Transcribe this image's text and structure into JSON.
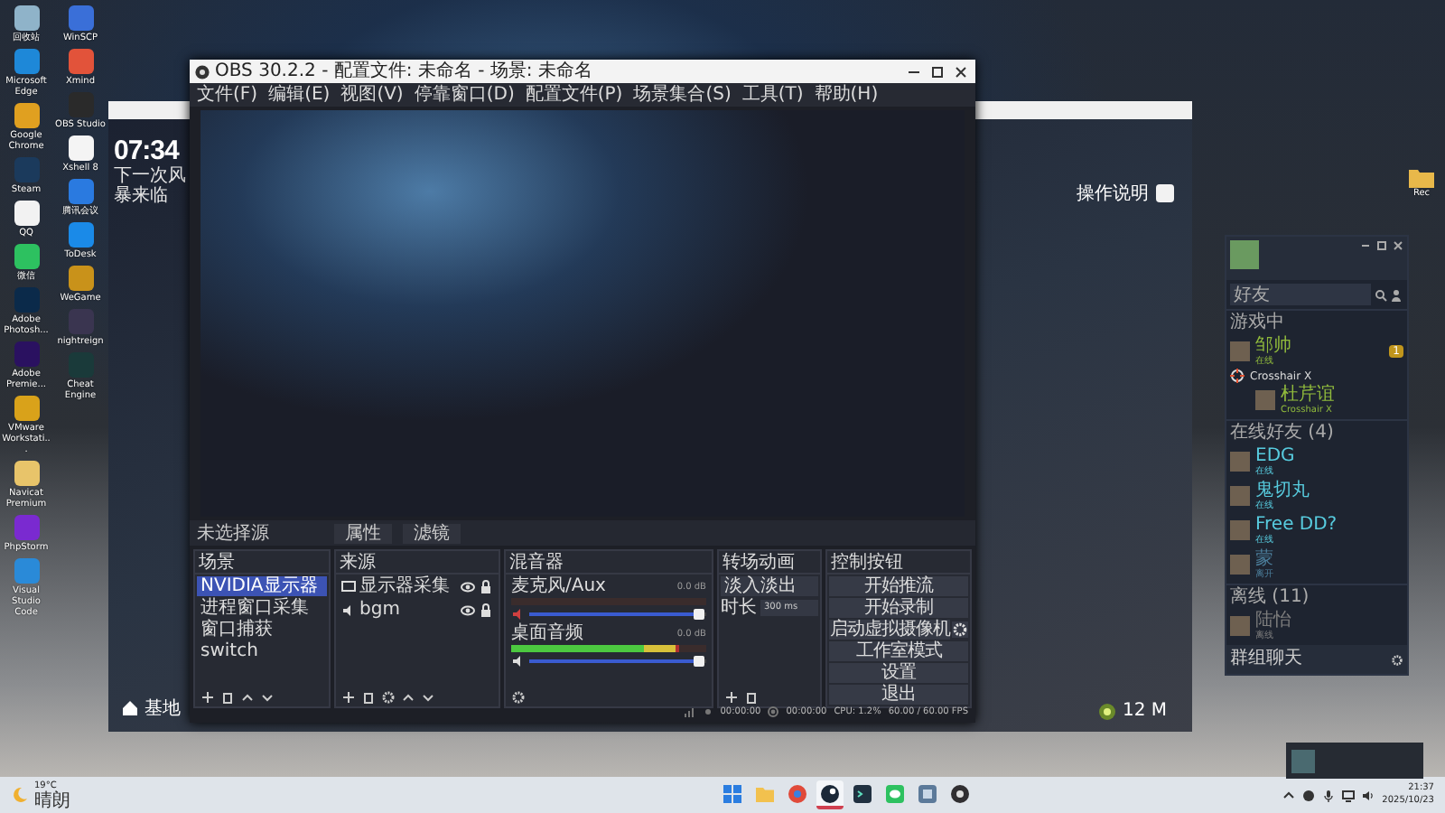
{
  "desktop_icons": {
    "left_column": [
      {
        "label": "回收站",
        "color": "#8fb3c9"
      },
      {
        "label": "Microsoft Edge",
        "color": "#1e88d8"
      },
      {
        "label": "Google Chrome",
        "color": "#e0a020"
      },
      {
        "label": "Steam",
        "color": "#1b3a5c"
      },
      {
        "label": "QQ",
        "color": "#f2f2f2"
      },
      {
        "label": "微信",
        "color": "#2dc160"
      },
      {
        "label": "Adobe Photosh...",
        "color": "#0b2a4a"
      },
      {
        "label": "Adobe Premie...",
        "color": "#2a1160"
      },
      {
        "label": "VMware Workstati...",
        "color": "#d9a21a"
      },
      {
        "label": "Navicat Premium",
        "color": "#e8c46a"
      },
      {
        "label": "PhpStorm",
        "color": "#7a2ad0"
      },
      {
        "label": "Visual Studio Code",
        "color": "#2a8ad8"
      }
    ],
    "right_column": [
      {
        "label": "WinSCP",
        "color": "#3a6fd8"
      },
      {
        "label": "Xmind",
        "color": "#e2533a"
      },
      {
        "label": "OBS Studio",
        "color": "#2a2a2a"
      },
      {
        "label": "Xshell 8",
        "color": "#f4f4f4"
      },
      {
        "label": "腾讯会议",
        "color": "#2a7ae0"
      },
      {
        "label": "ToDesk",
        "color": "#1a8ae8"
      },
      {
        "label": "WeGame",
        "color": "#c9921a"
      },
      {
        "label": "nightreign",
        "color": "#3a3550"
      },
      {
        "label": "Cheat Engine",
        "color": "#1a3a3a"
      }
    ]
  },
  "desktop_right_icon": {
    "label": "Rec"
  },
  "game_window": {
    "clock": "07:34",
    "subtitle": "下一次风暴来临",
    "help_label": "操作说明",
    "location": "基地",
    "distance": "12 M"
  },
  "obs": {
    "title": "OBS 30.2.2 - 配置文件: 未命名 - 场景: 未命名",
    "menu": [
      "文件(F)",
      "编辑(E)",
      "视图(V)",
      "停靠窗口(D)",
      "配置文件(P)",
      "场景集合(S)",
      "工具(T)",
      "帮助(H)"
    ],
    "source_bar": {
      "label": "未选择源",
      "buttons": [
        "属性",
        "滤镜"
      ]
    },
    "scenes": {
      "title": "场景",
      "items": [
        {
          "name": "NVIDIA显示器",
          "selected": true
        },
        {
          "name": "进程窗口采集",
          "selected": false
        },
        {
          "name": "窗口捕获",
          "selected": false
        },
        {
          "name": "switch",
          "selected": false
        }
      ]
    },
    "sources": {
      "title": "来源",
      "items": [
        {
          "name": "显示器采集",
          "kind": "display",
          "visible": true,
          "locked": true
        },
        {
          "name": "bgm",
          "kind": "audio",
          "visible": true,
          "locked": true
        }
      ]
    },
    "mixer": {
      "title": "混音器",
      "channels": [
        {
          "name": "麦克风/Aux",
          "reading": "0.0 dB",
          "muted": true,
          "meter": {
            "level": 0
          },
          "volume": {
            "level": 0.96
          }
        },
        {
          "name": "桌面音频",
          "reading": "0.0 dB",
          "muted": false,
          "meter": {
            "level": 0.86
          },
          "volume": {
            "level": 0.96
          }
        }
      ]
    },
    "transitions": {
      "title": "转场动画",
      "select": "淡入淡出",
      "duration_label": "时长",
      "duration": "300 ms"
    },
    "controls": {
      "title": "控制按钮",
      "buttons": [
        {
          "label": "开始推流",
          "kind": "plain"
        },
        {
          "label": "开始录制",
          "kind": "plain"
        },
        {
          "label": "启动虚拟摄像机",
          "kind": "with_settings"
        },
        {
          "label": "工作室模式",
          "kind": "plain"
        },
        {
          "label": "设置",
          "kind": "plain"
        },
        {
          "label": "退出",
          "kind": "plain"
        }
      ]
    },
    "status": {
      "stream_time": "00:00:00",
      "record_time": "00:00:00",
      "cpu": "CPU: 1.2%",
      "fps": "60.00 / 60.00 FPS"
    }
  },
  "friends": {
    "search_placeholder": "好友",
    "sections": [
      {
        "title": "游戏中",
        "items": [
          {
            "kind": "friend",
            "name": "邹帅",
            "status": "在线",
            "color": "#90ba3c",
            "badge": "1"
          },
          {
            "kind": "game",
            "name": "Crosshair X",
            "friends": [
              {
                "name": "杜芹谊",
                "status": "Crosshair X",
                "color": "#90ba3c"
              }
            ]
          }
        ]
      },
      {
        "title": "在线好友 (4)",
        "items": [
          {
            "kind": "friend",
            "name": "EDG",
            "status": "在线",
            "color": "#57cbde"
          },
          {
            "kind": "friend",
            "name": "鬼切丸",
            "status": "在线",
            "color": "#57cbde"
          },
          {
            "kind": "friend",
            "name": "Free DD?",
            "status": "在线",
            "color": "#57cbde"
          },
          {
            "kind": "friend",
            "name": "蒙",
            "status": "离开",
            "color": "#4c7f9c"
          }
        ]
      },
      {
        "title": "离线 (11)",
        "items": [
          {
            "kind": "friend",
            "name": "陆怡",
            "status": "离线",
            "color": "#7d7d7d"
          }
        ]
      }
    ],
    "footer": "群组聊天"
  },
  "taskbar": {
    "weather": {
      "temp": "19°C",
      "text": "晴朗"
    },
    "apps": [
      {
        "kind": "start",
        "active": false
      },
      {
        "kind": "folder",
        "active": false
      },
      {
        "kind": "browser",
        "active": false
      },
      {
        "kind": "steam",
        "active": true
      },
      {
        "kind": "terminal",
        "active": false
      },
      {
        "kind": "chat",
        "active": false
      },
      {
        "kind": "game",
        "active": false
      },
      {
        "kind": "obs",
        "active": false
      }
    ],
    "clock": {
      "time": "21:37",
      "date": "2025/10/23"
    }
  }
}
